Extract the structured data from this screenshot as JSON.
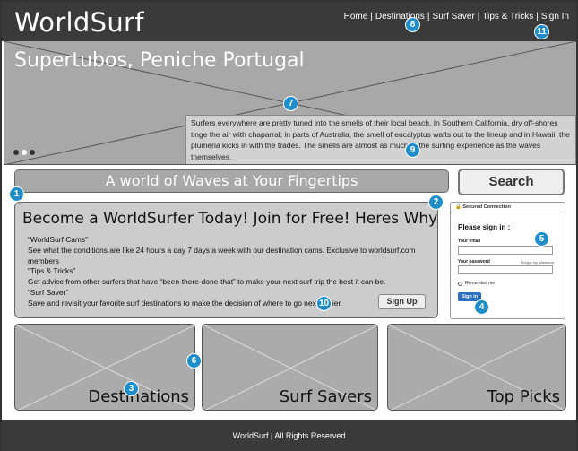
{
  "header": {
    "logo": "WorldSurf",
    "nav": [
      "Home",
      "Destinations",
      "Surf Saver",
      "Tips & Tricks",
      "Sign In"
    ],
    "nav_separator": "|"
  },
  "hero": {
    "title": "Supertubos, Peniche Portugal",
    "caption": "Surfers everywhere are pretty tuned into the smells of their local beach. In Southern California, dry off-shores tinge the air with chaparral; in parts of Australia, the smell of eucalyptus wafts out to the lineup and in Hawaii, the plumeria kicks in with the trades. The smells are almost as much of the surfing experience as the waves themselves.",
    "slides": 3,
    "active_slide": 2
  },
  "search": {
    "placeholder": "A world of Waves at Your Fingertips",
    "button": "Search"
  },
  "promo": {
    "title": "Become a WorldSurfer Today! Join for Free! Heres Why",
    "lines": [
      "“WorldSurf Cams”",
      "See what the conditions are like 24 hours a day 7 days a week with our destination cams. Exclusive to worldsurf.com members",
      "“Tips & Tricks”",
      "Get advice from other surfers that have “been-there-done-that” to make your next surf trip the best it can be.",
      "“Surf Saver”",
      "Save and revisit your favorite surf destinations to make the decision of where to go next easier."
    ],
    "signup": "Sign Up"
  },
  "signin": {
    "secure": "Secured Connection",
    "title": "Please sign in :",
    "email_label": "Your email",
    "password_label": "Your password",
    "forgot": "I forgot my password",
    "remember": "Remember me",
    "button": "Sign in"
  },
  "tiles": [
    "Destinations",
    "Surf Savers",
    "Top Picks"
  ],
  "footer": "WorldSurf | All Rights Reserved",
  "badges": [
    "1",
    "2",
    "3",
    "4",
    "5",
    "6",
    "7",
    "8",
    "9",
    "10",
    "11"
  ],
  "colors": {
    "header": "#3a3a3a",
    "placeholder": "#a8a8a8",
    "badge": "#1d8ec9"
  }
}
